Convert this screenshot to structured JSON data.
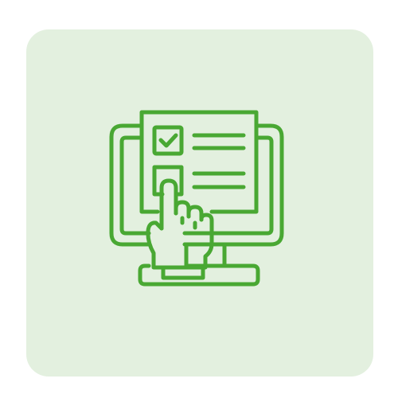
{
  "colors": {
    "background": "#ffffff",
    "tile": "#e3f0df",
    "stroke": "#49a833"
  },
  "icon": {
    "name": "online-survey-checklist-icon",
    "parts": [
      "monitor-icon",
      "checklist-form-icon",
      "checked-checkbox-icon",
      "empty-checkbox-icon",
      "pointing-hand-icon"
    ]
  }
}
